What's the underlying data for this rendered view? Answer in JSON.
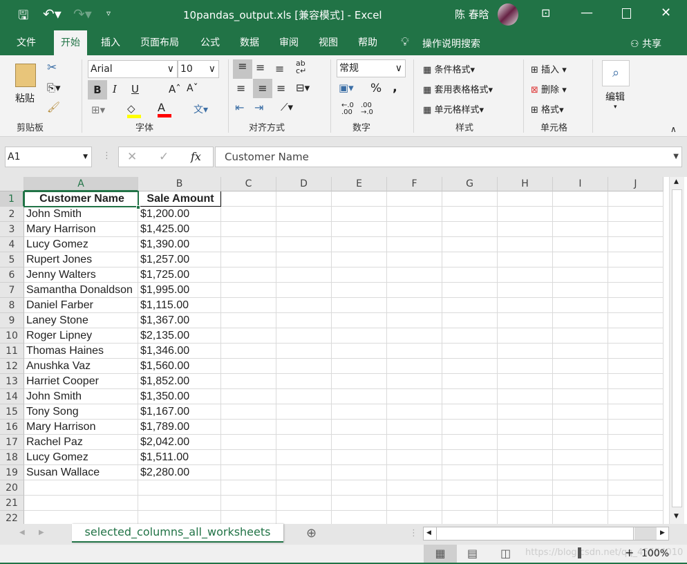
{
  "title_bar": {
    "title": "10pandas_output.xls [兼容模式] - Excel",
    "user": "陈 春晗"
  },
  "ribbon_tabs": [
    "文件",
    "开始",
    "插入",
    "页面布局",
    "公式",
    "数据",
    "审阅",
    "视图",
    "帮助"
  ],
  "active_tab": "开始",
  "tell_me": "操作说明搜索",
  "share": "共享",
  "clipboard": {
    "paste": "粘贴",
    "group": "剪贴板"
  },
  "font": {
    "name": "Arial",
    "size": "10",
    "bold": "B",
    "italic": "I",
    "underline": "U",
    "group": "字体",
    "highlight_color": "#ffff00",
    "font_color": "#ff0000"
  },
  "alignment": {
    "group": "对齐方式"
  },
  "number": {
    "format": "常规",
    "percent": "%",
    "comma": ",",
    "group": "数字"
  },
  "styles": {
    "conditional": "条件格式",
    "table": "套用表格格式",
    "cell": "单元格样式",
    "group": "样式"
  },
  "cells": {
    "insert": "插入",
    "delete": "删除",
    "format": "格式",
    "group": "单元格"
  },
  "editing": {
    "label": "编辑"
  },
  "formula_bar": {
    "name_box": "A1",
    "fx": "fx",
    "content": "Customer Name"
  },
  "columns": [
    "A",
    "B",
    "C",
    "D",
    "E",
    "F",
    "G",
    "H",
    "I",
    "J"
  ],
  "header": [
    "Customer Name",
    "Sale Amount"
  ],
  "rows": [
    [
      "John Smith",
      "$1,200.00"
    ],
    [
      "Mary Harrison",
      "$1,425.00"
    ],
    [
      "Lucy Gomez",
      "$1,390.00"
    ],
    [
      "Rupert Jones",
      "$1,257.00"
    ],
    [
      "Jenny Walters",
      "$1,725.00"
    ],
    [
      "Samantha Donaldson",
      "$1,995.00"
    ],
    [
      "Daniel Farber",
      "$1,115.00"
    ],
    [
      "Laney Stone",
      "$1,367.00"
    ],
    [
      "Roger Lipney",
      "$2,135.00"
    ],
    [
      "Thomas Haines",
      "$1,346.00"
    ],
    [
      "Anushka Vaz",
      "$1,560.00"
    ],
    [
      "Harriet Cooper",
      "$1,852.00"
    ],
    [
      "John Smith",
      "$1,350.00"
    ],
    [
      "Tony Song",
      "$1,167.00"
    ],
    [
      "Mary Harrison",
      "$1,789.00"
    ],
    [
      "Rachel Paz",
      "$2,042.00"
    ],
    [
      "Lucy Gomez",
      "$1,511.00"
    ],
    [
      "Susan Wallace",
      "$2,280.00"
    ]
  ],
  "row_numbers": [
    "1",
    "2",
    "3",
    "4",
    "5",
    "6",
    "7",
    "8",
    "9",
    "10",
    "11",
    "12",
    "13",
    "14",
    "15",
    "16",
    "17",
    "18",
    "19",
    "20",
    "21",
    "22"
  ],
  "sheet_tab": "selected_columns_all_worksheets",
  "status": {
    "zoom": "100%",
    "watermark": "https://blog.csdn.net/qq_45554010"
  },
  "accent": "#217346"
}
